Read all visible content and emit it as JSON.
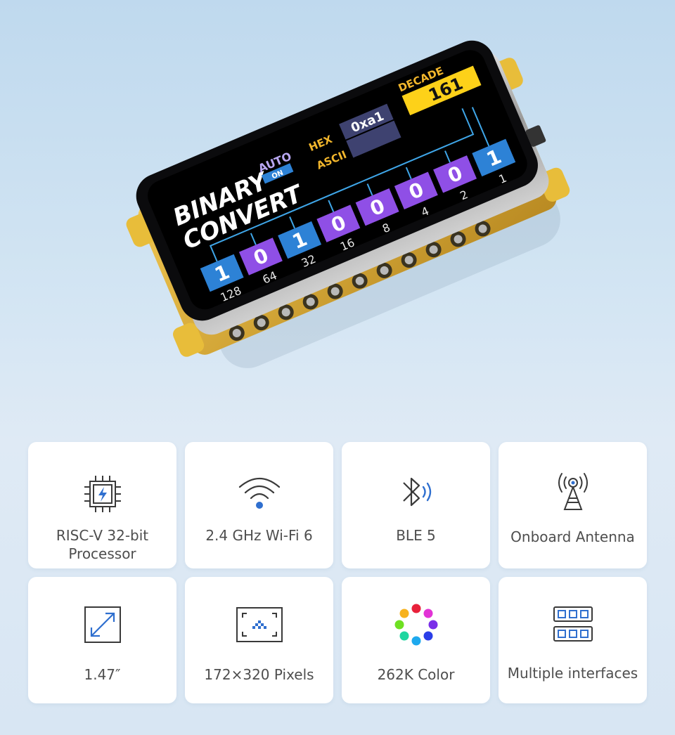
{
  "screen": {
    "title_line1": "BINARY",
    "title_line2": "CONVERT",
    "auto_label": "AUTO",
    "on_label": "ON",
    "hex_label": "HEX",
    "ascii_label": "ASCII",
    "hex_value": "0xa1",
    "decade_label": "DECADE",
    "decade_value": "161",
    "bits": [
      {
        "bit": "1",
        "weight": "128"
      },
      {
        "bit": "0",
        "weight": "64"
      },
      {
        "bit": "1",
        "weight": "32"
      },
      {
        "bit": "0",
        "weight": "16"
      },
      {
        "bit": "0",
        "weight": "8"
      },
      {
        "bit": "0",
        "weight": "4"
      },
      {
        "bit": "0",
        "weight": "2"
      },
      {
        "bit": "1",
        "weight": "1"
      }
    ]
  },
  "features": [
    {
      "icon": "processor-icon",
      "label_line1": "RISC-V 32-bit",
      "label_line2": "Processor"
    },
    {
      "icon": "wifi-icon",
      "label_line1": "2.4 GHz Wi-Fi 6",
      "label_line2": ""
    },
    {
      "icon": "bluetooth-icon",
      "label_line1": "BLE 5",
      "label_line2": ""
    },
    {
      "icon": "antenna-icon",
      "label_line1": "Onboard Antenna",
      "label_line2": ""
    },
    {
      "icon": "resize-icon",
      "label_line1": "1.47″",
      "label_line2": ""
    },
    {
      "icon": "pixels-icon",
      "label_line1": "172×320 Pixels",
      "label_line2": ""
    },
    {
      "icon": "color-wheel-icon",
      "label_line1": "262K Color",
      "label_line2": ""
    },
    {
      "icon": "interfaces-icon",
      "label_line1": "Multiple interfaces",
      "label_line2": ""
    }
  ],
  "colors": {
    "bit_on": "#2d82d6",
    "bit_off": "#8f4fe6",
    "decade_box": "#fdd119",
    "screen_text": "#f2b62c",
    "icon_blue": "#2f6fcf"
  }
}
